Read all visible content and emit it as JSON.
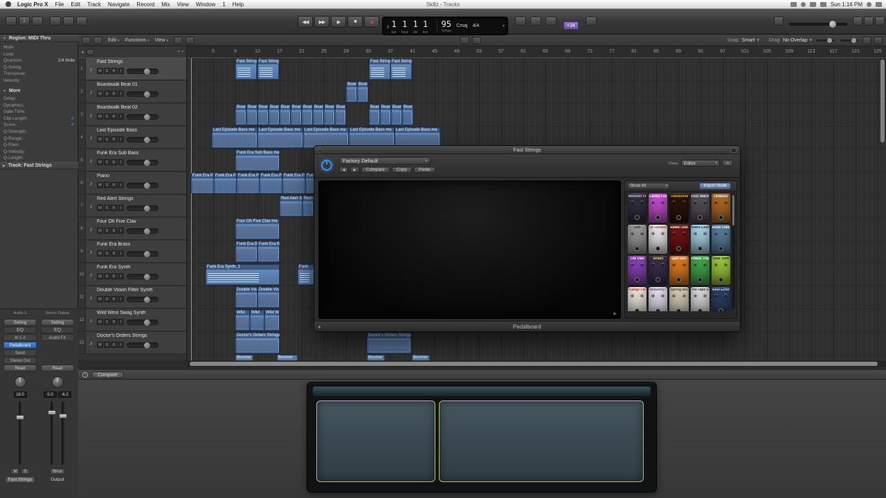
{
  "icons": {
    "note": "♪",
    "dropdown": "▾",
    "rewind": "◀◀",
    "forward": "▶▶",
    "play": "▶",
    "stop": "■",
    "record": "●",
    "back": "◀",
    "next": "▶",
    "close": "×",
    "disclosure_open": "▼",
    "disclosure_closed": "▶",
    "plus": "+",
    "link": "∞",
    "info": "i",
    "expand": "▶"
  },
  "menu_bar": {
    "menus": [
      "Logic Pro X",
      "File",
      "Edit",
      "Track",
      "Navigate",
      "Record",
      "Mix",
      "View",
      "Window",
      "1",
      "Help"
    ],
    "window_title": "Sk8z - Tracks",
    "clock": "Sun 1:16 PM"
  },
  "control_bar": {
    "lcd": {
      "position": [
        "1",
        "1",
        "1",
        "1"
      ],
      "position_labels": [
        "bar",
        "beat",
        "div",
        "tick"
      ],
      "tempo": "95",
      "tempo_label": "Tempo",
      "key": "Cmaj",
      "signature": "4/4"
    },
    "badge": "+34"
  },
  "arrange_toolbar": {
    "menus": [
      "Edit",
      "Functions",
      "View"
    ],
    "snap_label": "Snap:",
    "snap_value": "Smart",
    "drag_label": "Drag:",
    "drag_value": "No Overlap"
  },
  "inspector": {
    "region_header": "Region: MIDI Thru",
    "region_rows": [
      {
        "label": "Mute:",
        "value": ""
      },
      {
        "label": "Loop:",
        "value": ""
      },
      {
        "label": "Quantize:",
        "value": "1/4 Note"
      },
      {
        "label": "Q-Swing:",
        "value": ""
      },
      {
        "label": "Transpose:",
        "value": ""
      },
      {
        "label": "Velocity:",
        "value": ""
      }
    ],
    "more_header": "More",
    "more_rows": [
      {
        "label": "Delay:",
        "value": ""
      },
      {
        "label": "Dynamics:",
        "value": ""
      },
      {
        "label": "Gate Time:",
        "value": ""
      },
      {
        "label": "Clip Length:",
        "value": "✓"
      },
      {
        "label": "Score:",
        "value": "✓"
      },
      {
        "label": "Q-Strength:",
        "value": ""
      },
      {
        "label": "Q-Range:",
        "value": ""
      },
      {
        "label": "Q-Flam:",
        "value": ""
      },
      {
        "label": "Q-Velocity:",
        "value": ""
      },
      {
        "label": "Q-Length:",
        "value": ""
      }
    ],
    "track_header": "Track: Fast Strings",
    "channels": [
      {
        "name": "Audio 1",
        "slots": [
          "Setting",
          "EQ",
          "In 1-2",
          "Pedalboard",
          "Send",
          "Stereo Out",
          "Read"
        ],
        "value": "18.0",
        "buttons": [
          "M",
          "S"
        ],
        "label": "Fast Strings"
      },
      {
        "name": "Stereo Output",
        "slots": [
          "Setting",
          "EQ",
          "Audio FX",
          "",
          "",
          "",
          "Read"
        ],
        "value": "0.0",
        "value2": "-6.2",
        "buttons": [
          "Bnce"
        ],
        "label": "Output"
      }
    ]
  },
  "track_buttons": [
    "M",
    "S",
    "R",
    "I"
  ],
  "tracks": [
    {
      "num": "1",
      "name": "Fast Strings"
    },
    {
      "num": "2",
      "name": "Boardwalk Beat 01"
    },
    {
      "num": "3",
      "name": "Boardwalk Beat 02"
    },
    {
      "num": "4",
      "name": "Last Episode Bass"
    },
    {
      "num": "5",
      "name": "Funk Era Sub Bass"
    },
    {
      "num": "6",
      "name": "Piano"
    },
    {
      "num": "7",
      "name": "Red Alert Strings"
    },
    {
      "num": "8",
      "name": "Four Oh Five Clav"
    },
    {
      "num": "9",
      "name": "Funk Era Brass"
    },
    {
      "num": "10",
      "name": "Funk Era Synth"
    },
    {
      "num": "11",
      "name": "Double Vision Filter Synth"
    },
    {
      "num": "12",
      "name": "Wild West Swag Synth"
    },
    {
      "num": "13",
      "name": "Doctor's Orders Strings"
    }
  ],
  "ruler": {
    "first": 5,
    "step_bars": 4,
    "count": 31
  },
  "regions": [
    [
      1,
      70,
      31,
      "Fast Strings",
      "m"
    ],
    [
      1,
      102,
      31,
      "Fast Strings",
      "m"
    ],
    [
      1,
      263,
      31,
      "Fast Strings",
      "m"
    ],
    [
      1,
      294,
      31,
      "Fast Strings",
      "m"
    ],
    [
      2,
      230,
      16,
      "Boar",
      "a"
    ],
    [
      2,
      246,
      16,
      "Boar",
      "a"
    ],
    [
      3,
      70,
      16,
      "Boar",
      "a"
    ],
    [
      3,
      86,
      16,
      "Boar",
      "a"
    ],
    [
      3,
      102,
      16,
      "Boar",
      "a"
    ],
    [
      3,
      118,
      16,
      "Boar",
      "a"
    ],
    [
      3,
      134,
      16,
      "Boar",
      "a"
    ],
    [
      3,
      150,
      16,
      "Boar",
      "a"
    ],
    [
      3,
      166,
      16,
      "Boar",
      "a"
    ],
    [
      3,
      182,
      16,
      "Boar",
      "a"
    ],
    [
      3,
      198,
      16,
      "Boar",
      "a"
    ],
    [
      3,
      214,
      16,
      "Boar",
      "a"
    ],
    [
      3,
      263,
      16,
      "Boar",
      "a"
    ],
    [
      3,
      279,
      16,
      "Boar",
      "a"
    ],
    [
      3,
      295,
      16,
      "Boar",
      "a"
    ],
    [
      3,
      311,
      16,
      "Boar",
      "a"
    ],
    [
      4,
      36,
      66,
      "Last Episode Bass me",
      "a"
    ],
    [
      4,
      102,
      66,
      "Last Episode Bass me",
      "a"
    ],
    [
      4,
      168,
      66,
      "Last Episode Bass me",
      "a"
    ],
    [
      4,
      234,
      66,
      "Last Episode Bass me",
      "a"
    ],
    [
      4,
      300,
      66,
      "Last Episode Bass me",
      "a"
    ],
    [
      5,
      70,
      64,
      "Funk Era Sub Bass me",
      "a"
    ],
    [
      6,
      6,
      33,
      "Funk Era P",
      "a"
    ],
    [
      6,
      39,
      33,
      "Funk Era P",
      "a"
    ],
    [
      6,
      72,
      33,
      "Funk Era P",
      "a"
    ],
    [
      6,
      105,
      33,
      "Funk Era P",
      "a"
    ],
    [
      6,
      138,
      33,
      "Funk Era P",
      "a"
    ],
    [
      6,
      171,
      33,
      "Funk Era P",
      "a"
    ],
    [
      7,
      134,
      33,
      "Red Alert S",
      "a"
    ],
    [
      7,
      167,
      16,
      "Red A",
      "a"
    ],
    [
      8,
      70,
      64,
      "Four Oh Five Clav me",
      "a"
    ],
    [
      9,
      70,
      32,
      "Funk Era B",
      "a"
    ],
    [
      9,
      102,
      32,
      "Funk Era B",
      "a"
    ],
    [
      10,
      27,
      107,
      "Funk Era Synth, 1",
      "m"
    ],
    [
      10,
      160,
      24,
      "Funk",
      "m"
    ],
    [
      11,
      70,
      32,
      "Double Vis",
      "a"
    ],
    [
      11,
      102,
      32,
      "Double Vis",
      "a"
    ],
    [
      12,
      70,
      21,
      "Wild",
      "a"
    ],
    [
      12,
      91,
      21,
      "Wild",
      "a"
    ],
    [
      12,
      112,
      22,
      "Wild W",
      "a"
    ],
    [
      13,
      70,
      64,
      "Doctor's Orders Strings",
      "a"
    ],
    [
      13,
      260,
      64,
      "Doctor's Orders Strings",
      "a"
    ],
    [
      14,
      70,
      26,
      "Boomer",
      "c"
    ],
    [
      14,
      130,
      30,
      "Boomer",
      "c"
    ],
    [
      14,
      260,
      26,
      "Boomer",
      "c"
    ],
    [
      14,
      325,
      26,
      "Boomer",
      "c"
    ]
  ],
  "plugin": {
    "title": "Fast Strings",
    "preset": "Factory Default",
    "nav_buttons": [
      "Compare",
      "Copy",
      "Paste"
    ],
    "view_label": "View:",
    "view_value": "Editor",
    "browser_filter": "Show All",
    "browser_import": "Import Mode",
    "footer": "Pedalboard",
    "pedals": [
      {
        "name": "Monster Fuzz",
        "bg": "#33303f",
        "fg": "#d8c7ff"
      },
      {
        "name": "Candy Fuzz",
        "bg": "#c44fd0",
        "fg": "#ffffff"
      },
      {
        "name": "TubeBurner",
        "bg": "#2d120c",
        "fg": "#ffb84d"
      },
      {
        "name": "Fuzz Machine",
        "bg": "#54505a",
        "fg": "#eeeeee"
      },
      {
        "name": "Octafuzz",
        "bg": "#b06a28",
        "fg": "#ffffff"
      },
      {
        "name": "Grit",
        "bg": "#9b9b9b",
        "fg": "#222222"
      },
      {
        "name": "Dr. Octave",
        "bg": "#ececec",
        "fg": "#cc2222"
      },
      {
        "name": "Rawk! Distortion",
        "bg": "#6e1514",
        "fg": "#ffffdd"
      },
      {
        "name": "Retro Chorus",
        "bg": "#a9d6e8",
        "fg": "#223344"
      },
      {
        "name": "Robo Flanger",
        "bg": "#5b7f9e",
        "fg": "#ffffff"
      },
      {
        "name": "The Vibe",
        "bg": "#8a42b5",
        "fg": "#ffffff"
      },
      {
        "name": "Wham",
        "bg": "#3c2d50",
        "fg": "#ffcc66"
      },
      {
        "name": "Spin Box",
        "bg": "#e07a22",
        "fg": "#ffffff"
      },
      {
        "name": "Phase Tripper",
        "bg": "#43a84e",
        "fg": "#ffffff"
      },
      {
        "name": "Total Tremolo",
        "bg": "#9fc93f",
        "fg": "#223344"
      },
      {
        "name": "Flange Factory",
        "bg": "#efe9dc",
        "fg": "#cc3333"
      },
      {
        "name": "Heavenly Chorus",
        "bg": "#e8e2f2",
        "fg": "#555577"
      },
      {
        "name": "Spring Box",
        "bg": "#d9cfb8",
        "fg": "#554433"
      },
      {
        "name": "Tru-Tape Delay",
        "bg": "#dddddd",
        "fg": "#333333"
      },
      {
        "name": "Blue Echo",
        "bg": "#2a3f66",
        "fg": "#ccddee"
      }
    ]
  },
  "bottom": {
    "compare": "Compare"
  }
}
